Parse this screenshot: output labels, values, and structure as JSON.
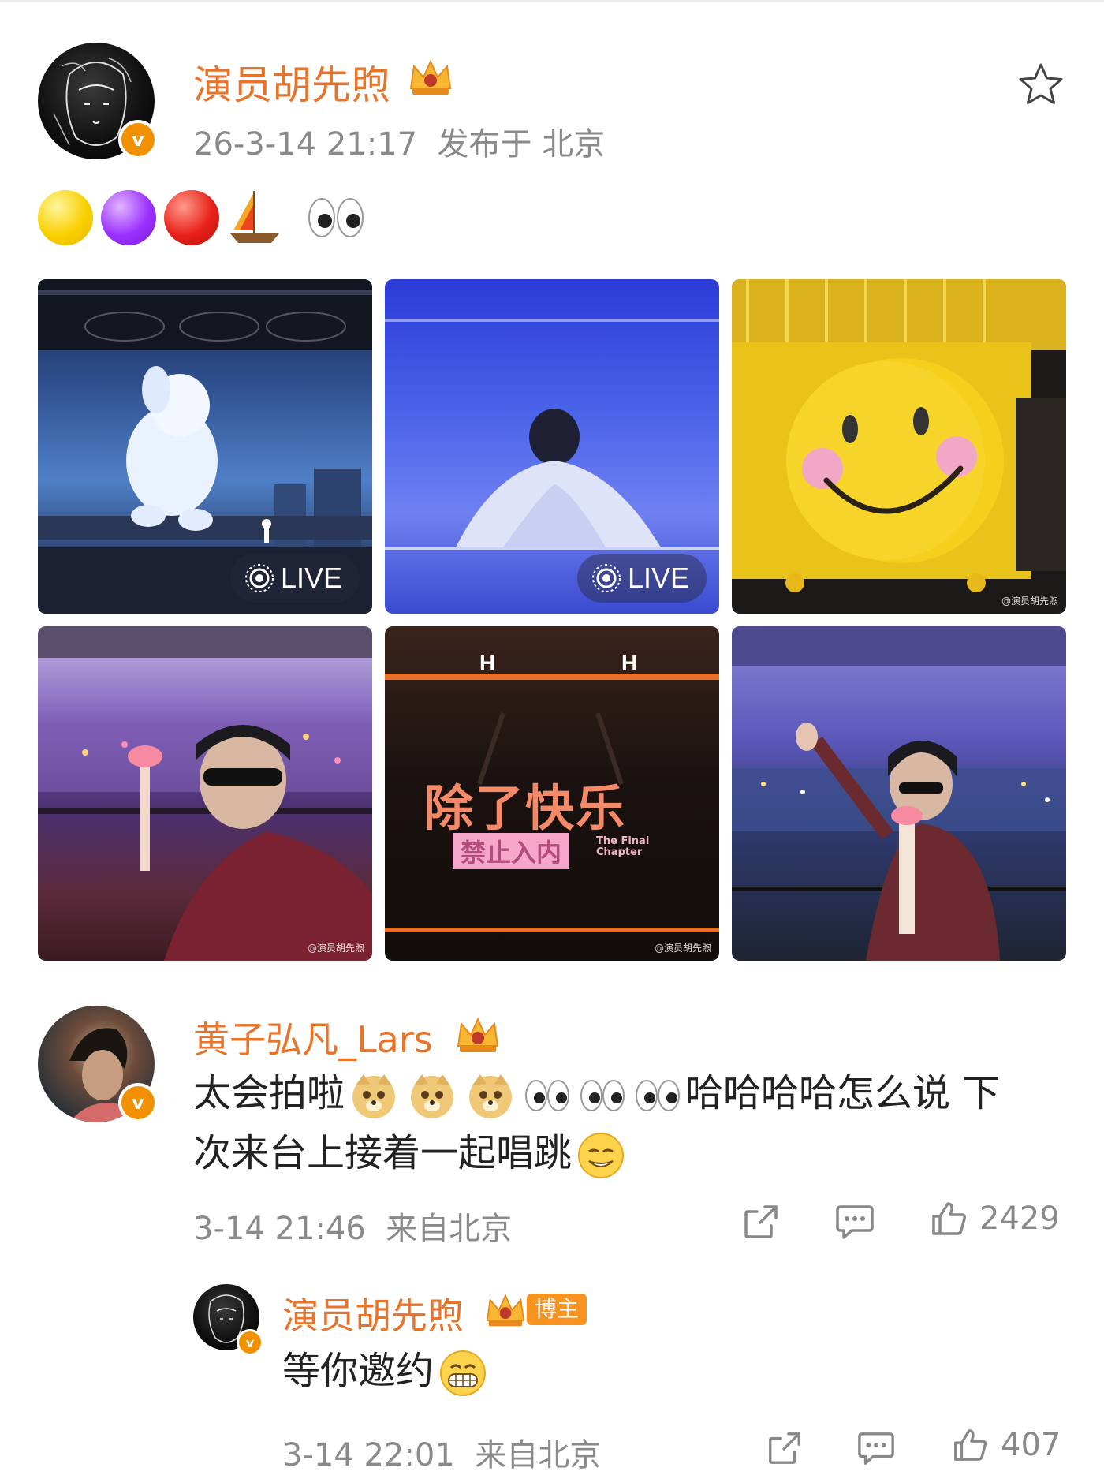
{
  "post": {
    "author": "演员胡先煦",
    "timestamp": "26-3-14 21:17",
    "location": "发布于 北京",
    "emojis": [
      "yellow-circle",
      "purple-circle",
      "red-circle",
      "sailboat",
      "eyes"
    ],
    "photos": [
      {
        "live": "LIVE",
        "watermark": ""
      },
      {
        "live": "LIVE",
        "watermark": ""
      },
      {
        "live": "",
        "watermark": "@演员胡先煦"
      },
      {
        "live": "",
        "watermark": "@演员胡先煦"
      },
      {
        "live": "",
        "watermark": "@演员胡先煦",
        "sign_main": "除了快乐",
        "sign_pink": "禁止入内",
        "sign_small": "The Final Chapter"
      },
      {
        "live": "",
        "watermark": ""
      }
    ]
  },
  "comments": [
    {
      "author": "黄子弘凡_Lars",
      "text_before_emoji": "太会拍啦",
      "text_after_emoji": "哈哈哈哈怎么说 下",
      "text_line2": "次来台上接着一起唱跳",
      "time": "3-14 21:46",
      "location": "来自北京",
      "likes": "2429"
    }
  ],
  "reply": {
    "author": "演员胡先煦",
    "badge": "博主",
    "text": "等你邀约",
    "time": "3-14 22:01",
    "location": "来自北京",
    "likes": "407"
  },
  "colors": {
    "name_orange": "#e8732a",
    "meta_gray": "#8a8a8a",
    "verified_orange": "#f29100"
  },
  "icons": {
    "favorite": "star-outline-icon",
    "share": "share-icon",
    "comment": "comment-icon",
    "like": "thumbs-up-icon"
  }
}
